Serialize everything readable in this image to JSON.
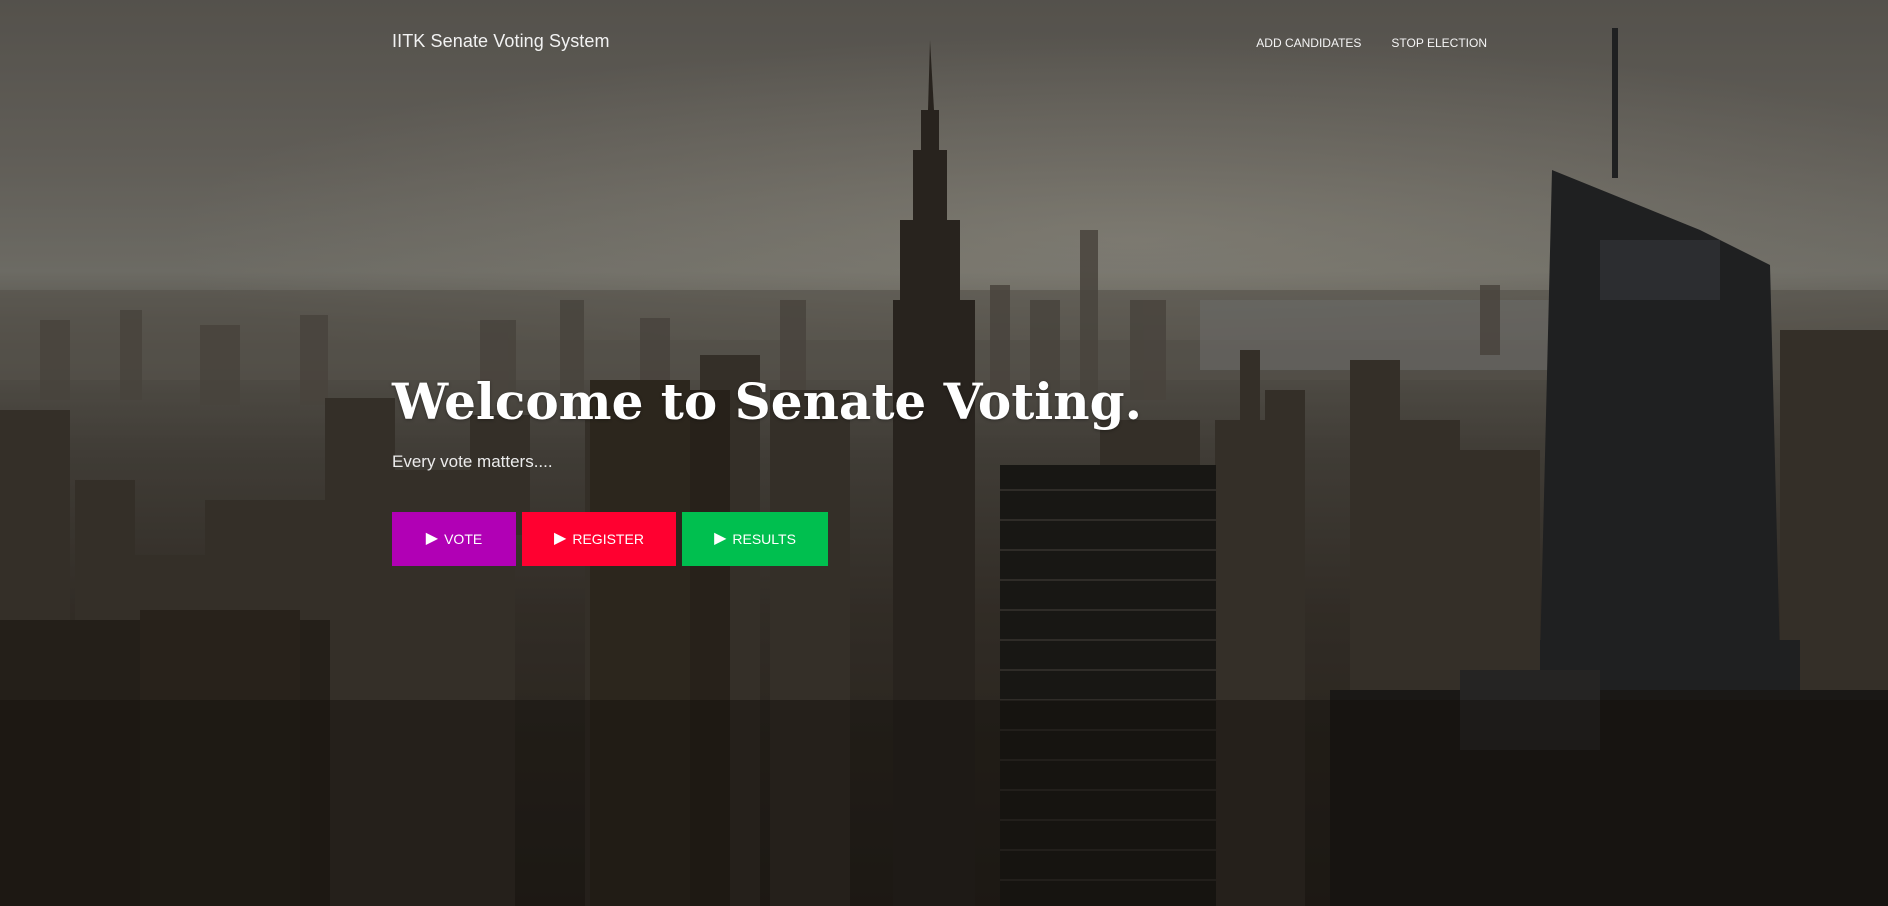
{
  "navbar": {
    "brand": "IITK Senate Voting System",
    "links": [
      {
        "label": "ADD CANDIDATES"
      },
      {
        "label": "STOP ELECTION"
      }
    ]
  },
  "hero": {
    "title": "Welcome to Senate Voting.",
    "subtitle": "Every vote matters....",
    "buttons": [
      {
        "label": "VOTE",
        "icon": "play-icon",
        "color": "#b100b5"
      },
      {
        "label": "REGISTER",
        "icon": "play-icon",
        "color": "#ff0030"
      },
      {
        "label": "RESULTS",
        "icon": "play-icon",
        "color": "#00bf4f"
      }
    ]
  }
}
